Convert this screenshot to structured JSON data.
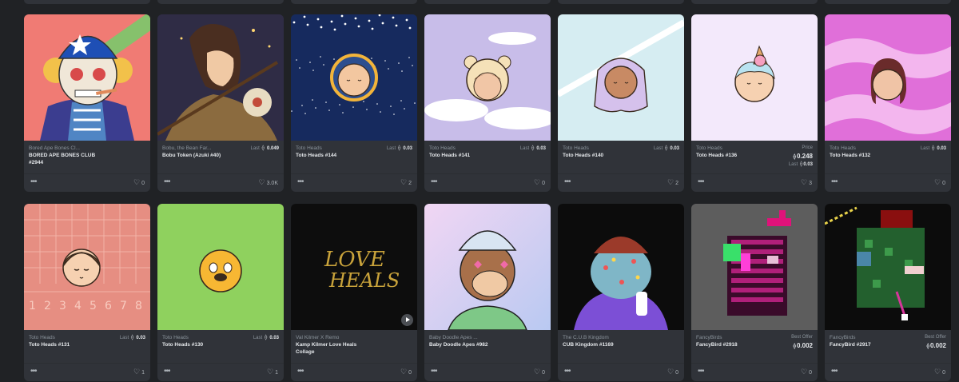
{
  "cards_row1": [
    {
      "collection": "Bored Ape Bones Cl...",
      "title": "BORED APE BONES CLUB #2944",
      "price_label": "",
      "price": "",
      "likes": "0",
      "art": "ape-bones"
    },
    {
      "collection": "Bobu, the Bean Far...",
      "title": "Bobu Token (Azuki #40)",
      "price_label": "Last",
      "price": "0.049",
      "likes": "3.0K",
      "art": "bobu"
    },
    {
      "collection": "Toto Heads",
      "title": "Toto Heads #144",
      "price_label": "Last",
      "price": "0.03",
      "likes": "2",
      "art": "space"
    },
    {
      "collection": "Toto Heads",
      "title": "Toto Heads #141",
      "price_label": "Last",
      "price": "0.03",
      "likes": "0",
      "art": "bear"
    },
    {
      "collection": "Toto Heads",
      "title": "Toto Heads #140",
      "price_label": "Last",
      "price": "0.03",
      "likes": "2",
      "art": "lilac"
    },
    {
      "collection": "Toto Heads",
      "title": "Toto Heads #136",
      "price_label": "Price",
      "price": "0.248",
      "sub_label": "Last",
      "sub_price": "0.03",
      "likes": "3",
      "art": "icecream"
    },
    {
      "collection": "Toto Heads",
      "title": "Toto Heads #132",
      "price_label": "Last",
      "price": "0.03",
      "likes": "0",
      "art": "pink"
    }
  ],
  "cards_row2": [
    {
      "collection": "Toto Heads",
      "title": "Toto Heads #131",
      "price_label": "Last",
      "price": "0.03",
      "likes": "1",
      "art": "track"
    },
    {
      "collection": "Toto Heads",
      "title": "Toto Heads #130",
      "price_label": "Last",
      "price": "0.03",
      "likes": "1",
      "art": "yellow"
    },
    {
      "collection": "Val Kilmer X Remo",
      "title": "Kamp Kilmer Love Heals Collage",
      "price_label": "",
      "price": "",
      "likes": "0",
      "art": "love"
    },
    {
      "collection": "Baby Doodle Apes ...",
      "title": "Baby Doodle Apes #982",
      "price_label": "",
      "price": "",
      "likes": "0",
      "art": "doodle"
    },
    {
      "collection": "The C.U.B Kingdom",
      "title": "CUB Kingdom #1169",
      "price_label": "",
      "price": "",
      "likes": "0",
      "art": "cub"
    },
    {
      "collection": "FancyBirds",
      "title": "FancyBird #2918",
      "price_label": "Best Offer",
      "price": "0.002",
      "likes": "0",
      "art": "bird1"
    },
    {
      "collection": "FancyBirds",
      "title": "FancyBird #2917",
      "price_label": "Best Offer",
      "price": "0.002",
      "likes": "0",
      "art": "bird2"
    }
  ],
  "track_numbers": "1 2 3 4 5 6 7 8",
  "love_text_line1": "LOVE",
  "love_text_line2": "HEALS",
  "more_glyph": "•••",
  "heart_glyph": "♡",
  "eth_glyph": "⟠"
}
